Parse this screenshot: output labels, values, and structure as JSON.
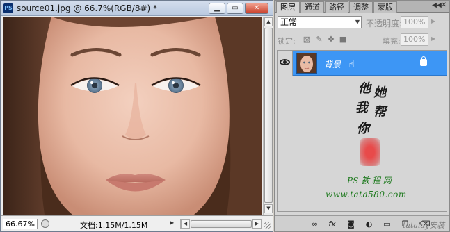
{
  "document": {
    "app_icon": "PS",
    "title": "source01.jpg @ 66.7%(RGB/8#) *",
    "window_buttons": {
      "minimize": "▁",
      "restore": "▭",
      "close": "✕"
    },
    "zoom": "66.67%",
    "info": "文档:1.15M/1.15M"
  },
  "layers_panel": {
    "tabs": [
      "图层",
      "通道",
      "路径",
      "调整",
      "蒙版"
    ],
    "active_tab": "图层",
    "blend_mode": "正常",
    "opacity_label": "不透明度:",
    "opacity": "100%",
    "lock_label": "锁定:",
    "fill_label": "填充:",
    "fill": "100%",
    "layers": [
      {
        "name": "背景",
        "visible": true,
        "locked": true,
        "selected": true
      }
    ],
    "watermark": {
      "glyphs": [
        "他",
        "她",
        "我",
        "帮",
        "你"
      ],
      "site_name": "PS 教 程 网",
      "url": "www.tata580.com"
    }
  },
  "corner_watermark": "tatalay安装",
  "colors": {
    "selection": "#3d96f5",
    "panel_bg": "#d6d6d6",
    "watermark_green": "#1f7a1f",
    "stamp_red": "#e84a4a"
  },
  "icons": {
    "visibility": "eye-icon",
    "lock": "lock-icon",
    "cursor": "hand-cursor-icon",
    "bottom_bar": [
      "link-layers-icon",
      "fx-icon",
      "mask-icon",
      "adjustment-layer-icon",
      "group-folder-icon",
      "new-layer-icon",
      "trash-icon"
    ]
  }
}
